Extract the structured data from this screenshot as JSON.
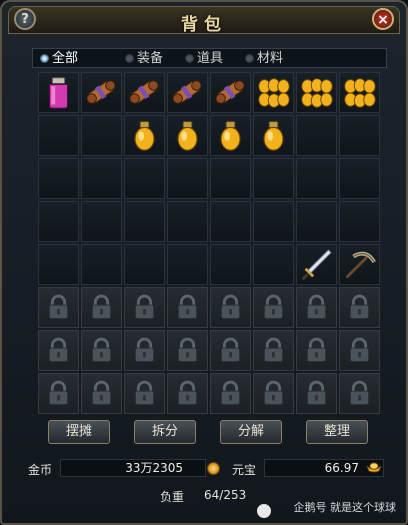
{
  "window": {
    "title": "背包",
    "help_label": "?",
    "close_label": "×"
  },
  "tabs": [
    {
      "label": "全部",
      "active": true
    },
    {
      "label": "装备",
      "active": false
    },
    {
      "label": "道具",
      "active": false
    },
    {
      "label": "材料",
      "active": false
    }
  ],
  "inventory": {
    "columns": 8,
    "slots": [
      "pink-potion-icon",
      "scroll-icon",
      "scroll-icon",
      "scroll-icon",
      "scroll-icon",
      "gold-potion-bundle-icon",
      "gold-potion-bundle-icon",
      "gold-potion-bundle-icon",
      "",
      "",
      "gold-potion-icon",
      "gold-potion-icon",
      "gold-potion-icon",
      "gold-potion-icon",
      "",
      "",
      "",
      "",
      "",
      "",
      "",
      "",
      "",
      "",
      "",
      "",
      "",
      "",
      "",
      "",
      "",
      "",
      "",
      "",
      "",
      "",
      "",
      "",
      "sword-icon",
      "pickaxe-icon",
      "lock-icon",
      "lock-icon",
      "lock-icon",
      "lock-icon",
      "lock-icon",
      "lock-icon",
      "lock-icon",
      "lock-icon",
      "lock-icon",
      "lock-icon",
      "lock-icon",
      "lock-icon",
      "lock-icon",
      "lock-icon",
      "lock-icon",
      "lock-icon",
      "lock-icon",
      "lock-icon",
      "lock-icon",
      "lock-icon",
      "lock-icon",
      "lock-icon",
      "lock-icon",
      "lock-icon"
    ]
  },
  "buttons": {
    "stall": "摆摊",
    "split": "拆分",
    "decompose": "分解",
    "sort": "整理"
  },
  "currency": {
    "gold_label": "金币",
    "gold_value": "33万2305",
    "yuanbao_label": "元宝",
    "yuanbao_value": "66.97"
  },
  "weight": {
    "label": "负重",
    "value": "64/253"
  },
  "watermark": "企鹅号 就是这个球球",
  "colors": {
    "gold_text": "#e9d7a3",
    "frame": "#5a5446",
    "active_tab": "#7eb9e8"
  }
}
